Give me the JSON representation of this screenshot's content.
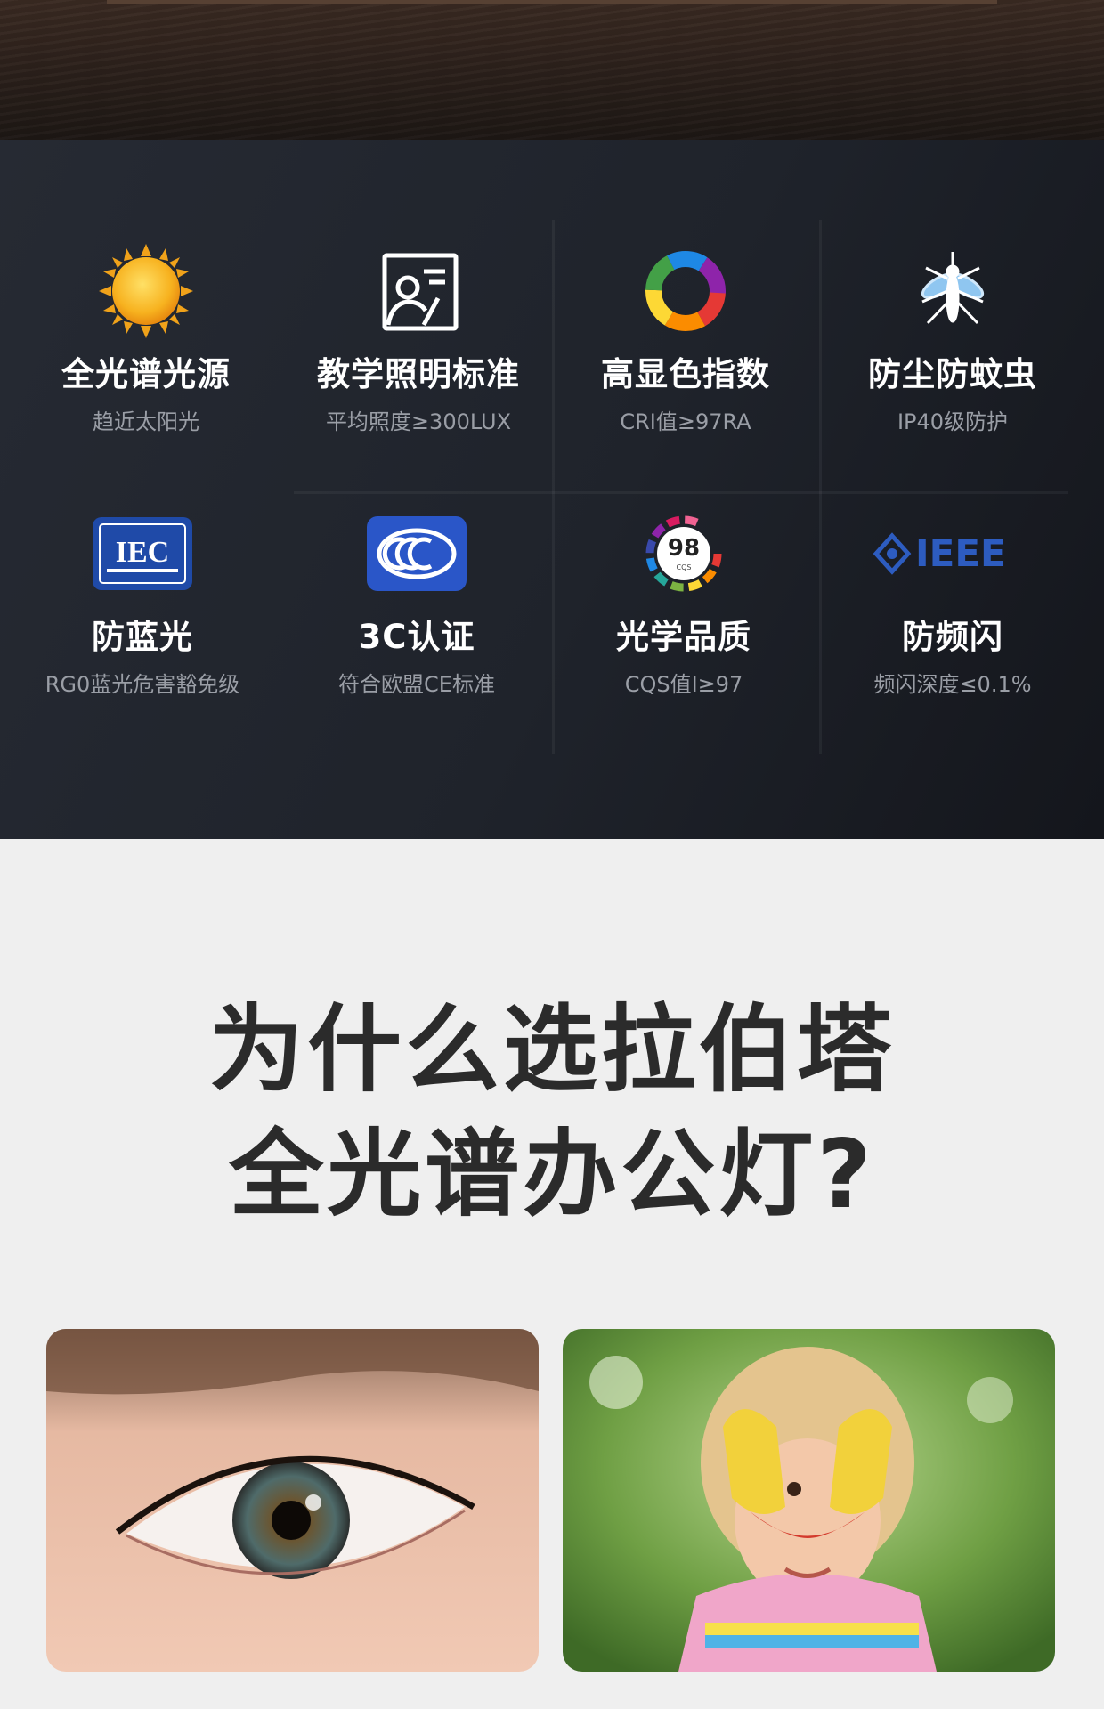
{
  "features": [
    {
      "id": "sun",
      "icon": "sun-icon",
      "title": "全光谱光源",
      "sub": "趋近太阳光"
    },
    {
      "id": "teaching",
      "icon": "teacher-board-icon",
      "title": "教学照明标准",
      "sub": "平均照度≥300LUX"
    },
    {
      "id": "cri",
      "icon": "color-ring-icon",
      "title": "高显色指数",
      "sub": "CRI值≥97RA"
    },
    {
      "id": "insect",
      "icon": "mosquito-icon",
      "title": "防尘防蚊虫",
      "sub": "IP40级防护"
    },
    {
      "id": "bluelight",
      "icon": "iec-logo-icon",
      "title": "防蓝光",
      "sub": "RG0蓝光危害豁免级"
    },
    {
      "id": "ccc",
      "icon": "ccc-logo-icon",
      "title": "3C认证",
      "sub": "符合欧盟CE标准"
    },
    {
      "id": "cqs",
      "icon": "cqs-badge-icon",
      "title": "光学品质",
      "sub": "CQS值I≥97"
    },
    {
      "id": "flicker",
      "icon": "ieee-logo-icon",
      "title": "防频闪",
      "sub": "频闪深度≤0.1%"
    }
  ],
  "badges": {
    "iec": "IEC",
    "cqs_value": "98",
    "cqs_small": "CQS",
    "ieee": "IEEE"
  },
  "headline": {
    "line1": "为什么选拉伯塔",
    "line2": "全光谱办公灯?"
  },
  "colors": {
    "panel": "#1f232b",
    "title_text": "#ffffff",
    "sub_text": "#9a9ea6",
    "headline_text": "#2b2b2b",
    "sun": "#f7b21f",
    "ccc_blue": "#2a56c8",
    "iec_blue": "#1f4aa8",
    "ieee_blue": "#2d5cc0"
  },
  "photos": [
    {
      "name": "eye-closeup-photo",
      "subject": "eye"
    },
    {
      "name": "child-hands-heart-photo",
      "subject": "child"
    }
  ]
}
